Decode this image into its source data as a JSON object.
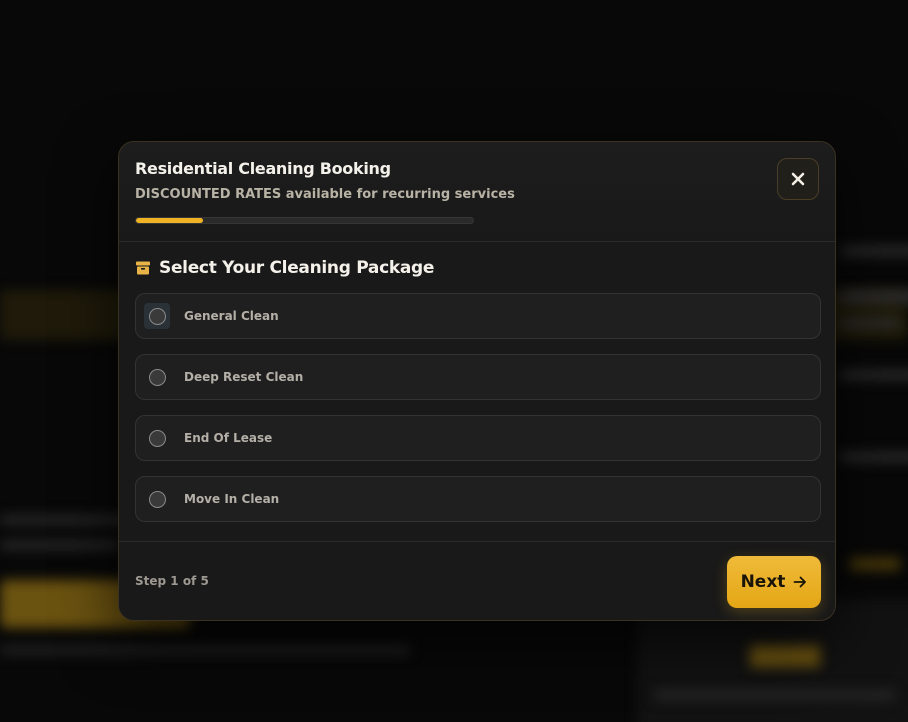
{
  "modal": {
    "title": "Residential Cleaning Booking",
    "subtitle": "DISCOUNTED RATES available for recurring services",
    "progress_fraction": 0.2,
    "close_icon": "close-icon"
  },
  "section": {
    "icon": "package-icon",
    "title": "Select Your Cleaning Package"
  },
  "options": [
    {
      "label": "General Clean",
      "selected": false,
      "focused": true
    },
    {
      "label": "Deep Reset Clean",
      "selected": false
    },
    {
      "label": "End Of Lease",
      "selected": false
    },
    {
      "label": "Move In Clean",
      "selected": false
    }
  ],
  "footer": {
    "step_text": "Step 1 of 5",
    "next_label": "Next",
    "next_icon": "arrow-right-icon"
  },
  "colors": {
    "accent": "#f0b323",
    "panel": "#191919",
    "background": "#080808"
  }
}
